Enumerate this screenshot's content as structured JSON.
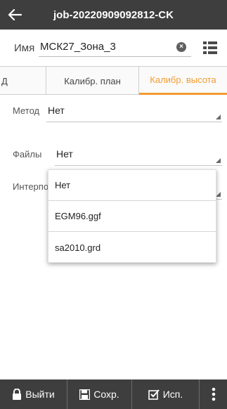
{
  "header": {
    "title": "job-20220909092812-CK",
    "back_icon": "arrow-left-icon"
  },
  "name_row": {
    "label": "Имя",
    "value": "МСК27_Зона_3"
  },
  "tabs": [
    {
      "label": "Д",
      "active": false
    },
    {
      "label": "Калибр. план",
      "active": false
    },
    {
      "label": "Калибр. высота",
      "active": true
    }
  ],
  "form": {
    "method": {
      "label": "Метод",
      "value": "Нет"
    },
    "files": {
      "label": "Файлы",
      "value": "Нет"
    },
    "interp": {
      "label": "Интерпо",
      "value": ""
    }
  },
  "dropdown": {
    "options": [
      "Нет",
      "EGM96.ggf",
      "sa2010.grd"
    ]
  },
  "bottom": {
    "exit": "Выйти",
    "save": "Сохр.",
    "use": "Исп."
  },
  "colors": {
    "bar": "#3e3e3e",
    "accent": "#f39c33"
  }
}
